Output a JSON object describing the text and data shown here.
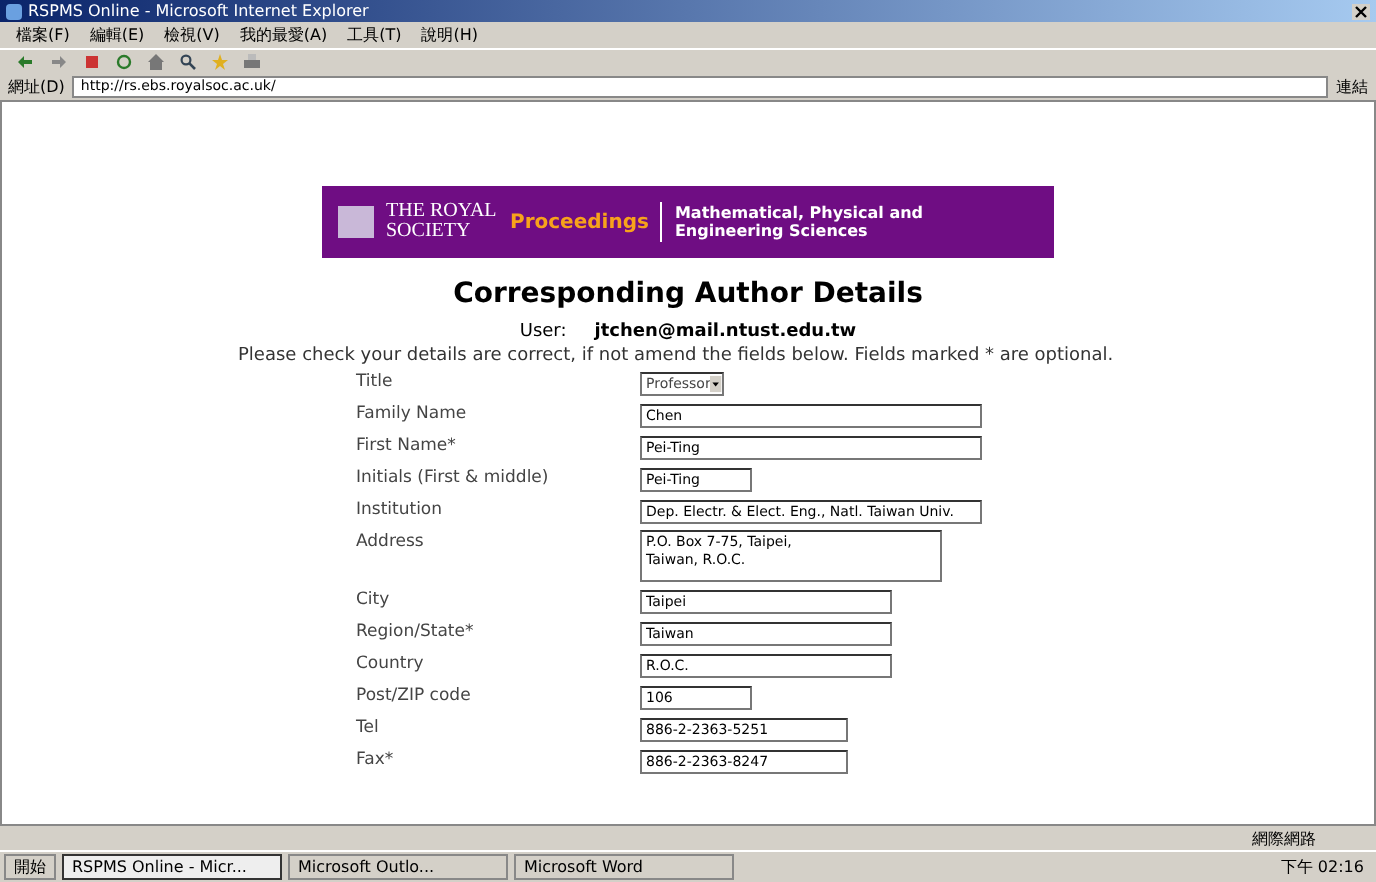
{
  "window": {
    "title": "RSPMS Online - Microsoft Internet Explorer"
  },
  "menu": [
    "檔案(F)",
    "編輯(E)",
    "檢視(V)",
    "我的最愛(A)",
    "工具(T)",
    "說明(H)"
  ],
  "address_bar": {
    "label": "網址(D)",
    "value": "http://rs.ebs.royalsoc.ac.uk/",
    "go": "連結"
  },
  "banner": {
    "society": "THE ROYAL SOCIETY",
    "journal": "Proceedings",
    "subtitle": "Mathematical, Physical and Engineering Sciences"
  },
  "heading": "Corresponding Author Details",
  "user": {
    "label": "User:",
    "value": "jtchen@mail.ntust.edu.tw"
  },
  "intro": "Please check your details are correct, if not amend the fields below. Fields marked * are optional.",
  "fields": [
    {
      "label": "Title",
      "kind": "select",
      "value": "Professor"
    },
    {
      "label": "Family Name",
      "kind": "long",
      "value": "Chen"
    },
    {
      "label": "First Name*",
      "kind": "long",
      "value": "Pei-Ting"
    },
    {
      "label": "Initials (First & middle)",
      "kind": "short",
      "value": "Pei-Ting"
    },
    {
      "label": "Institution",
      "kind": "long",
      "value": "Dep. Electr. & Elect. Eng., Natl. Taiwan Univ."
    },
    {
      "label": "Address",
      "kind": "textarea",
      "value": "P.O. Box 7-75, Taipei,\nTaiwan, R.O.C."
    },
    {
      "label": "City",
      "kind": "medium",
      "value": "Taipei"
    },
    {
      "label": "Region/State*",
      "kind": "medium",
      "value": "Taiwan"
    },
    {
      "label": "Country",
      "kind": "medium",
      "value": "R.O.C."
    },
    {
      "label": "Post/ZIP code",
      "kind": "short",
      "value": "106"
    },
    {
      "label": "Tel",
      "kind": "phone",
      "value": "886-2-2363-5251"
    },
    {
      "label": "Fax*",
      "kind": "phone",
      "value": "886-2-2363-8247"
    }
  ],
  "status_bar": {
    "zone": "網際網路"
  },
  "taskbar": {
    "start": "開始",
    "tasks": [
      {
        "label": "RSPMS Online - Micr...",
        "selected": true
      },
      {
        "label": "Microsoft Outlo...",
        "selected": false
      },
      {
        "label": "Microsoft Word",
        "selected": false
      }
    ],
    "clock": "下午 02:16"
  }
}
